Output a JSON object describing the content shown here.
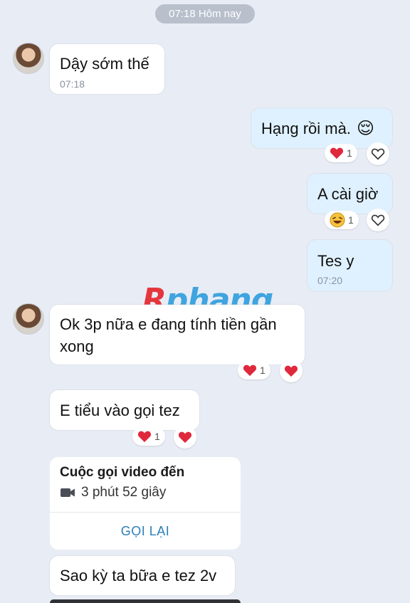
{
  "header": {
    "timestamp_label": "07:18 Hôm nay"
  },
  "watermark": {
    "text": "Rphang"
  },
  "messages": [
    {
      "id": "m1",
      "direction": "incoming",
      "text": "Dậy sớm thế",
      "time": "07:18"
    },
    {
      "id": "m2",
      "direction": "outgoing",
      "text": "Hạng rồi mà.",
      "emoji": "😌",
      "reaction": {
        "icon": "heart",
        "count": "1"
      }
    },
    {
      "id": "m3",
      "direction": "outgoing",
      "text": "A cài giờ",
      "reaction": {
        "icon": "laugh",
        "count": "1"
      }
    },
    {
      "id": "m4",
      "direction": "outgoing",
      "text": "Tes y",
      "time": "07:20"
    },
    {
      "id": "m5",
      "direction": "incoming",
      "text_line1": "Ok 3p nữa e đang tính tiền gần",
      "text_line2": "xong",
      "reaction": {
        "icon": "heart",
        "count": "1"
      }
    },
    {
      "id": "m6",
      "direction": "incoming",
      "text": "E tiểu vào gọi tez",
      "reaction": {
        "icon": "heart",
        "count": "1"
      }
    },
    {
      "id": "m7",
      "direction": "incoming",
      "type": "call",
      "title": "Cuộc gọi video đến",
      "duration": "3 phút 52 giây",
      "action": "GỌI LẠI"
    },
    {
      "id": "m8",
      "direction": "incoming",
      "text": "Sao kỳ ta bữa e tez 2v"
    }
  ],
  "colors": {
    "background": "#e8ecf5",
    "outgoing_bubble": "#dff1ff",
    "incoming_bubble": "#ffffff",
    "heart": "#e0283d",
    "callback": "#2a7fb8"
  }
}
